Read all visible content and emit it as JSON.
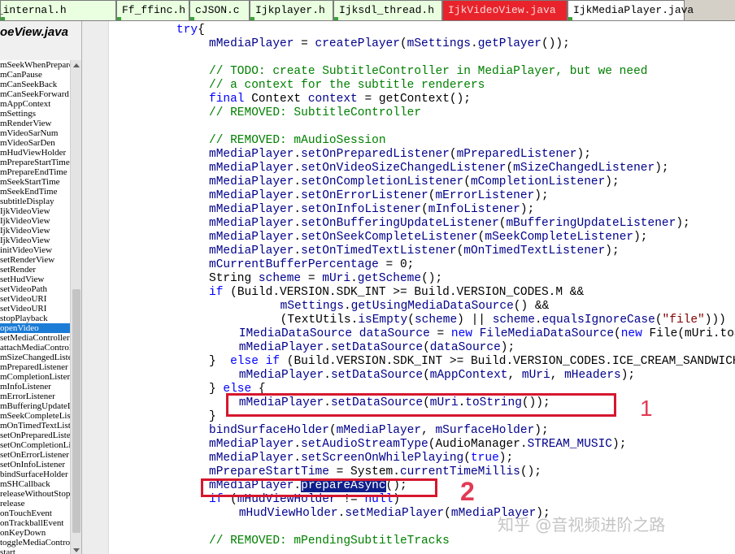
{
  "tabs": [
    {
      "label": "player_internal.h",
      "state": "normal"
    },
    {
      "label": "Ff_ffinc.h",
      "state": "normal"
    },
    {
      "label": "cJSON.c",
      "state": "normal"
    },
    {
      "label": "Ijkplayer.h",
      "state": "normal"
    },
    {
      "label": "Ijksdl_thread.h",
      "state": "normal"
    },
    {
      "label": "IjkVideoView.java",
      "state": "modified"
    },
    {
      "label": "IjkMediaPlayer.java",
      "state": "active"
    }
  ],
  "colors": {
    "keyword": "#0000ff",
    "comment": "#008000",
    "identifier": "#00008b",
    "string": "#800000",
    "annotation": "#d6172e",
    "selection": "#0f1f8a",
    "modified_tab": "#e8232b"
  },
  "left_panel": {
    "title": "oeView.java",
    "symbols": [
      "mSeekWhenPrepared",
      "mCanPause",
      "mCanSeekBack",
      "mCanSeekForward",
      "mAppContext",
      "mSettings",
      "mRenderView",
      "mVideoSarNum",
      "mVideoSarDen",
      "mHudViewHolder",
      "mPrepareStartTime",
      "mPrepareEndTime",
      "mSeekStartTime",
      "mSeekEndTime",
      "subtitleDisplay",
      "IjkVideoView",
      "IjkVideoView",
      "IjkVideoView",
      "IjkVideoView",
      "initVideoView",
      "setRenderView",
      "setRender",
      "setHudView",
      "setVideoPath",
      "setVideoURI",
      "setVideoURI",
      "stopPlayback",
      "openVideo",
      "setMediaController",
      "attachMediaController",
      "mSizeChangedListener",
      "mPreparedListener",
      "mCompletionListener",
      "mInfoListener",
      "mErrorListener",
      "mBufferingUpdateListener",
      "mSeekCompleteListener",
      "mOnTimedTextListener",
      "setOnPreparedListener",
      "setOnCompletionListener",
      "setOnErrorListener",
      "setOnInfoListener",
      "bindSurfaceHolder",
      "mSHCallback",
      "releaseWithoutStop",
      "release",
      "onTouchEvent",
      "onTrackballEvent",
      "onKeyDown",
      "toggleMediaControlsVisiblity",
      "start"
    ],
    "selected_index": 27
  },
  "code": [
    [
      [
        "kw",
        "try"
      ],
      [
        "",
        "{"
      ]
    ],
    [
      [
        "id",
        "mMediaPlayer"
      ],
      [
        "",
        " = "
      ],
      [
        "id",
        "createPlayer"
      ],
      [
        "",
        "("
      ],
      [
        "id",
        "mSettings"
      ],
      [
        "",
        "."
      ],
      [
        "id",
        "getPlayer"
      ],
      [
        "",
        "());"
      ]
    ],
    [],
    [
      [
        "cm",
        "// TODO: create SubtitleController in MediaPlayer, but we need"
      ]
    ],
    [
      [
        "cm",
        "// a context for the subtitle renderers"
      ]
    ],
    [
      [
        "kw",
        "final"
      ],
      [
        "",
        " Context "
      ],
      [
        "id",
        "context"
      ],
      [
        "",
        " = "
      ],
      [
        "",
        "getContext"
      ],
      [
        "",
        "();"
      ]
    ],
    [
      [
        "cm",
        "// REMOVED: SubtitleController"
      ]
    ],
    [],
    [
      [
        "cm",
        "// REMOVED: mAudioSession"
      ]
    ],
    [
      [
        "id",
        "mMediaPlayer"
      ],
      [
        "",
        "."
      ],
      [
        "id",
        "setOnPreparedListener"
      ],
      [
        "",
        "("
      ],
      [
        "id",
        "mPreparedListener"
      ],
      [
        "",
        ");"
      ]
    ],
    [
      [
        "id",
        "mMediaPlayer"
      ],
      [
        "",
        "."
      ],
      [
        "id",
        "setOnVideoSizeChangedListener"
      ],
      [
        "",
        "("
      ],
      [
        "id",
        "mSizeChangedListener"
      ],
      [
        "",
        ");"
      ]
    ],
    [
      [
        "id",
        "mMediaPlayer"
      ],
      [
        "",
        "."
      ],
      [
        "id",
        "setOnCompletionListener"
      ],
      [
        "",
        "("
      ],
      [
        "id",
        "mCompletionListener"
      ],
      [
        "",
        ");"
      ]
    ],
    [
      [
        "id",
        "mMediaPlayer"
      ],
      [
        "",
        "."
      ],
      [
        "id",
        "setOnErrorListener"
      ],
      [
        "",
        "("
      ],
      [
        "id",
        "mErrorListener"
      ],
      [
        "",
        ");"
      ]
    ],
    [
      [
        "id",
        "mMediaPlayer"
      ],
      [
        "",
        "."
      ],
      [
        "id",
        "setOnInfoListener"
      ],
      [
        "",
        "("
      ],
      [
        "id",
        "mInfoListener"
      ],
      [
        "",
        ");"
      ]
    ],
    [
      [
        "id",
        "mMediaPlayer"
      ],
      [
        "",
        "."
      ],
      [
        "id",
        "setOnBufferingUpdateListener"
      ],
      [
        "",
        "("
      ],
      [
        "id",
        "mBufferingUpdateListener"
      ],
      [
        "",
        ");"
      ]
    ],
    [
      [
        "id",
        "mMediaPlayer"
      ],
      [
        "",
        "."
      ],
      [
        "id",
        "setOnSeekCompleteListener"
      ],
      [
        "",
        "("
      ],
      [
        "id",
        "mSeekCompleteListener"
      ],
      [
        "",
        ");"
      ]
    ],
    [
      [
        "id",
        "mMediaPlayer"
      ],
      [
        "",
        "."
      ],
      [
        "id",
        "setOnTimedTextListener"
      ],
      [
        "",
        "("
      ],
      [
        "id",
        "mOnTimedTextListener"
      ],
      [
        "",
        ");"
      ]
    ],
    [
      [
        "id",
        "mCurrentBufferPercentage"
      ],
      [
        "",
        " = "
      ],
      [
        "",
        "0"
      ],
      [
        "",
        ";"
      ]
    ],
    [
      [
        "",
        "String "
      ],
      [
        "id",
        "scheme"
      ],
      [
        "",
        " = "
      ],
      [
        "id",
        "mUri"
      ],
      [
        "",
        "."
      ],
      [
        "id",
        "getScheme"
      ],
      [
        "",
        "();"
      ]
    ],
    [
      [
        "kw",
        "if"
      ],
      [
        "",
        " ("
      ],
      [
        "",
        "Build.VERSION.SDK_INT >= Build.VERSION_CODES.M &&"
      ]
    ],
    [
      [
        "",
        "        "
      ],
      [
        "id",
        "mSettings"
      ],
      [
        "",
        "."
      ],
      [
        "id",
        "getUsingMediaDataSource"
      ],
      [
        "",
        "() &&"
      ]
    ],
    [
      [
        "",
        "        (TextUtils."
      ],
      [
        "id",
        "isEmpty"
      ],
      [
        "",
        "("
      ],
      [
        "id",
        "scheme"
      ],
      [
        "",
        ") || "
      ],
      [
        "id",
        "scheme"
      ],
      [
        "",
        "."
      ],
      [
        "id",
        "equalsIgnoreCase"
      ],
      [
        "",
        "("
      ],
      [
        "st",
        "\"file\""
      ],
      [
        "",
        ")))"
      ]
    ],
    [
      [
        "",
        "    "
      ],
      [
        "id",
        "IMediaDataSource"
      ],
      [
        "",
        " "
      ],
      [
        "id",
        "dataSource"
      ],
      [
        "",
        " = "
      ],
      [
        "kw",
        "new"
      ],
      [
        "",
        " "
      ],
      [
        "id",
        "FileMediaDataSource"
      ],
      [
        "",
        "("
      ],
      [
        "kw",
        "new"
      ],
      [
        "",
        " File(mUri.toString()));"
      ]
    ],
    [
      [
        "",
        "    "
      ],
      [
        "id",
        "mMediaPlayer"
      ],
      [
        "",
        "."
      ],
      [
        "id",
        "setDataSource"
      ],
      [
        "",
        "("
      ],
      [
        "id",
        "dataSource"
      ],
      [
        "",
        ");"
      ]
    ],
    [
      [
        "",
        "}  "
      ],
      [
        "kw",
        "else if"
      ],
      [
        "",
        " ("
      ],
      [
        "",
        "Build.VERSION.SDK_INT >= Build.VERSION_CODES.ICE_CREAM_SANDWICH) {"
      ]
    ],
    [
      [
        "",
        "    "
      ],
      [
        "id",
        "mMediaPlayer"
      ],
      [
        "",
        "."
      ],
      [
        "id",
        "setDataSource"
      ],
      [
        "",
        "("
      ],
      [
        "id",
        "mAppContext"
      ],
      [
        "",
        ", "
      ],
      [
        "id",
        "mUri"
      ],
      [
        "",
        ", "
      ],
      [
        "id",
        "mHeaders"
      ],
      [
        "",
        ");"
      ]
    ],
    [
      [
        "",
        "} "
      ],
      [
        "kw",
        "else"
      ],
      [
        "",
        " {"
      ]
    ],
    [
      [
        "",
        "    "
      ],
      [
        "id",
        "mMediaPlayer"
      ],
      [
        "",
        "."
      ],
      [
        "id",
        "setDataSource"
      ],
      [
        "",
        "("
      ],
      [
        "id",
        "mUri"
      ],
      [
        "",
        "."
      ],
      [
        "id",
        "toString"
      ],
      [
        "",
        "());"
      ]
    ],
    [
      [
        "",
        "}"
      ]
    ],
    [
      [
        "id",
        "bindSurfaceHolder"
      ],
      [
        "",
        "("
      ],
      [
        "id",
        "mMediaPlayer"
      ],
      [
        "",
        ", "
      ],
      [
        "id",
        "mSurfaceHolder"
      ],
      [
        "",
        ");"
      ]
    ],
    [
      [
        "id",
        "mMediaPlayer"
      ],
      [
        "",
        "."
      ],
      [
        "id",
        "setAudioStreamType"
      ],
      [
        "",
        "(AudioManager."
      ],
      [
        "id",
        "STREAM_MUSIC"
      ],
      [
        "",
        ");"
      ]
    ],
    [
      [
        "id",
        "mMediaPlayer"
      ],
      [
        "",
        "."
      ],
      [
        "id",
        "setScreenOnWhilePlaying"
      ],
      [
        "",
        "("
      ],
      [
        "kw",
        "true"
      ],
      [
        "",
        ");"
      ]
    ],
    [
      [
        "id",
        "mPrepareStartTime"
      ],
      [
        "",
        " = System."
      ],
      [
        "id",
        "currentTimeMillis"
      ],
      [
        "",
        "();"
      ]
    ],
    [
      [
        "id",
        "mMediaPlayer"
      ],
      [
        "",
        "."
      ],
      [
        "hl",
        "prepareAsync"
      ],
      [
        "",
        "();"
      ]
    ],
    [
      [
        "kw",
        "if"
      ],
      [
        "",
        " ("
      ],
      [
        "id",
        "mHudViewHolder"
      ],
      [
        "",
        " != "
      ],
      [
        "kw",
        "null"
      ],
      [
        "",
        ")"
      ]
    ],
    [
      [
        "",
        "    "
      ],
      [
        "id",
        "mHudViewHolder"
      ],
      [
        "",
        "."
      ],
      [
        "id",
        "setMediaPlayer"
      ],
      [
        "",
        "("
      ],
      [
        "id",
        "mMediaPlayer"
      ],
      [
        "",
        ");"
      ]
    ],
    [],
    [
      [
        "cm",
        "// REMOVED: mPendingSubtitleTracks"
      ]
    ]
  ],
  "annotations": {
    "one": "1",
    "two": "2"
  },
  "watermark": "知乎 @音视频进阶之路"
}
